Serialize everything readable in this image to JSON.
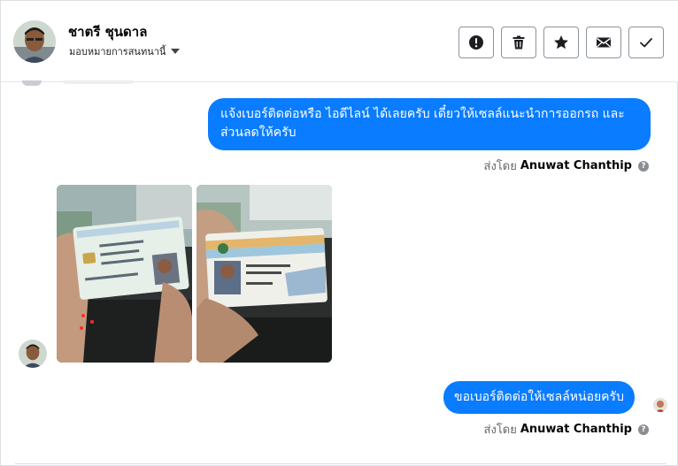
{
  "header": {
    "contact_name": "ชาตรี ชุนดาล",
    "assign_label": "มอบหมายการสนทนานี้",
    "actions": [
      {
        "name": "report-button",
        "icon": "alert-circle-icon"
      },
      {
        "name": "delete-button",
        "icon": "trash-icon"
      },
      {
        "name": "star-button",
        "icon": "star-icon"
      },
      {
        "name": "mark-unread-button",
        "icon": "envelope-icon"
      },
      {
        "name": "mark-done-button",
        "icon": "check-icon"
      }
    ]
  },
  "messages": [
    {
      "type": "outgoing",
      "text": "แจ้งเบอร์ติดต่อหรือ ไอดีไลน์ ได้เลยครับ เดี๋ยวให้เซลล์แนะนำการออกรถ และ ส่วนลดให้ครับ",
      "sent_by_prefix": "ส่งโดย",
      "sent_by_name": "Anuwat Chanthip"
    },
    {
      "type": "incoming-photos",
      "photos": [
        "thai-national-id-card-photo",
        "driver-license-card-photo"
      ]
    },
    {
      "type": "outgoing",
      "text": "ขอเบอร์ติดต่อให้เซลล์หน่อยครับ",
      "sent_by_prefix": "ส่งโดย",
      "sent_by_name": "Anuwat Chanthip"
    }
  ],
  "colors": {
    "bubble": "#0a7cff",
    "border": "#dddfe2",
    "muted_text": "#65676b"
  },
  "help_glyph": "?"
}
